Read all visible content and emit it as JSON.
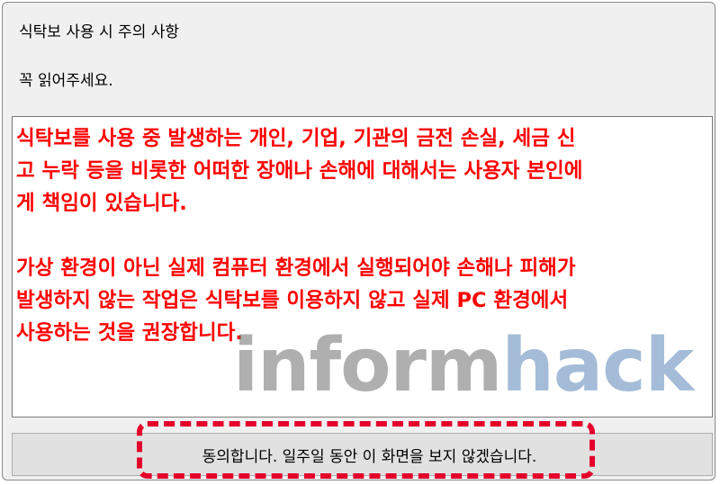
{
  "dialog": {
    "title": "식탁보 사용 시 주의 사항",
    "subtitle": "꼭 읽어주세요.",
    "notice": {
      "line1": "식탁보를 사용 중 발생하는 개인, 기업, 기관의 금전 손실, 세금 신",
      "line2": "고 누락 등을 비롯한 어떠한 장애나 손해에 대해서는 사용자 본인에",
      "line3": "게 책임이 있습니다.",
      "line4": "가상 환경이 아닌 실제 컴퓨터 환경에서 실행되어야 손해나 피해가",
      "line5": "발생하지 않는 작업은 식탁보를 이용하지 않고 실제 PC 환경에서",
      "line6": "사용하는 것을 권장합니다."
    },
    "agree_button_label": "동의합니다. 일주일 동안 이 화면을 보지 않겠습니다."
  },
  "watermark": {
    "part1": "inform",
    "part2": "hack"
  },
  "colors": {
    "notice_text": "#ff0000",
    "highlight": "#e4002b",
    "watermark_gray": "#6f6f6f",
    "watermark_blue": "#5b86b8"
  }
}
